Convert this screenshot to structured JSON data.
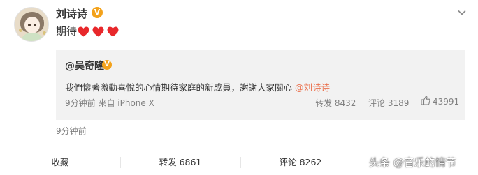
{
  "post": {
    "username": "刘诗诗",
    "verified_badge": "V",
    "text": "期待",
    "hearts": 3,
    "timestamp": "9分钟前"
  },
  "repost": {
    "username": "@吴奇隆",
    "verified_badge": "V",
    "text": "我們懷著激動喜悅的心情期待家庭的新成員，謝謝大家關心 ",
    "mention": "@刘诗诗",
    "meta": "9分钟前 来自 iPhone X",
    "forward_label": "转发 8432",
    "comment_label": "评论 3189",
    "like_count": "43991"
  },
  "actions": {
    "favorite": "收藏",
    "forward": "转发 6861",
    "comment": "评论 8262"
  },
  "watermark": "头条 @音乐的情节",
  "icons": {
    "menu": "chevron-down-icon",
    "like": "thumbs-up-icon",
    "heart": "red-heart-icon"
  },
  "colors": {
    "mention": "#eb7350",
    "verified": "#f3a21b",
    "heart": "#e8282b",
    "repost_bg": "#f2f2f2"
  }
}
